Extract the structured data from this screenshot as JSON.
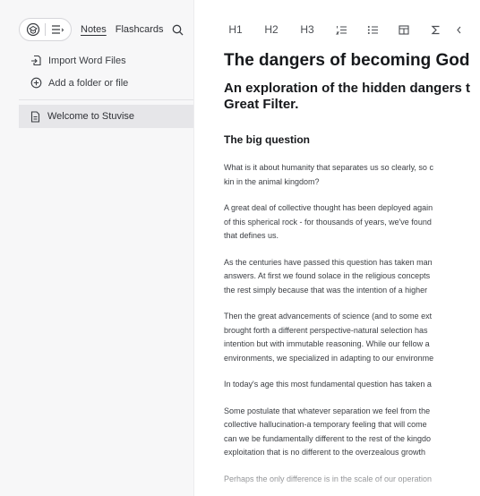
{
  "sidebar": {
    "tabs": [
      {
        "label": "Notes",
        "active": true
      },
      {
        "label": "Flashcards",
        "active": false
      }
    ],
    "actions": [
      {
        "label": "Import Word Files",
        "icon": "import-icon"
      },
      {
        "label": "Add a folder or file",
        "icon": "add-circle-icon"
      }
    ],
    "notes": [
      {
        "label": "Welcome to Stuvise",
        "icon": "document-icon",
        "selected": true
      }
    ]
  },
  "toolbar": {
    "items": [
      "H1",
      "H2",
      "H3",
      "ordered-list-icon",
      "bullet-list-icon",
      "table-icon",
      "sigma-icon",
      "code-icon"
    ],
    "h1": "H1",
    "h2": "H2",
    "h3": "H3"
  },
  "document": {
    "title": "The dangers of becoming God",
    "subtitle_lines": [
      "An exploration of the hidden dangers t",
      "Great Filter."
    ],
    "section_heading": "The big question",
    "paragraphs": [
      [
        "What is it about humanity that separates us so clearly, so c",
        "kin in the animal kingdom?"
      ],
      [
        "A great deal of collective thought has been deployed again",
        "of this spherical rock - for thousands of years, we've found",
        "that defines us."
      ],
      [
        "As the centuries have passed this question has taken man",
        "answers. At first we found solace in the religious concepts",
        "the rest simply because that was the intention of a higher "
      ],
      [
        "Then the great advancements of science (and to some ext",
        "brought forth a different perspective-natural selection has",
        "intention but with immutable reasoning. While our fellow a",
        "environments, we specialized in adapting to our environme"
      ],
      [
        "In today's age this most fundamental question has taken a"
      ],
      [
        "Some postulate that whatever separation we feel from the",
        "collective hallucination-a temporary feeling that will come",
        "can we be fundamentally different to the rest of the kingdo",
        "exploitation that is no different to the overzealous growth "
      ],
      [
        "Perhaps the only difference is in the scale of our operation"
      ]
    ]
  },
  "colors": {
    "sidebar_bg": "#f7f7f8",
    "selected_bg": "#e6e6e9",
    "text": "#1f2328"
  }
}
